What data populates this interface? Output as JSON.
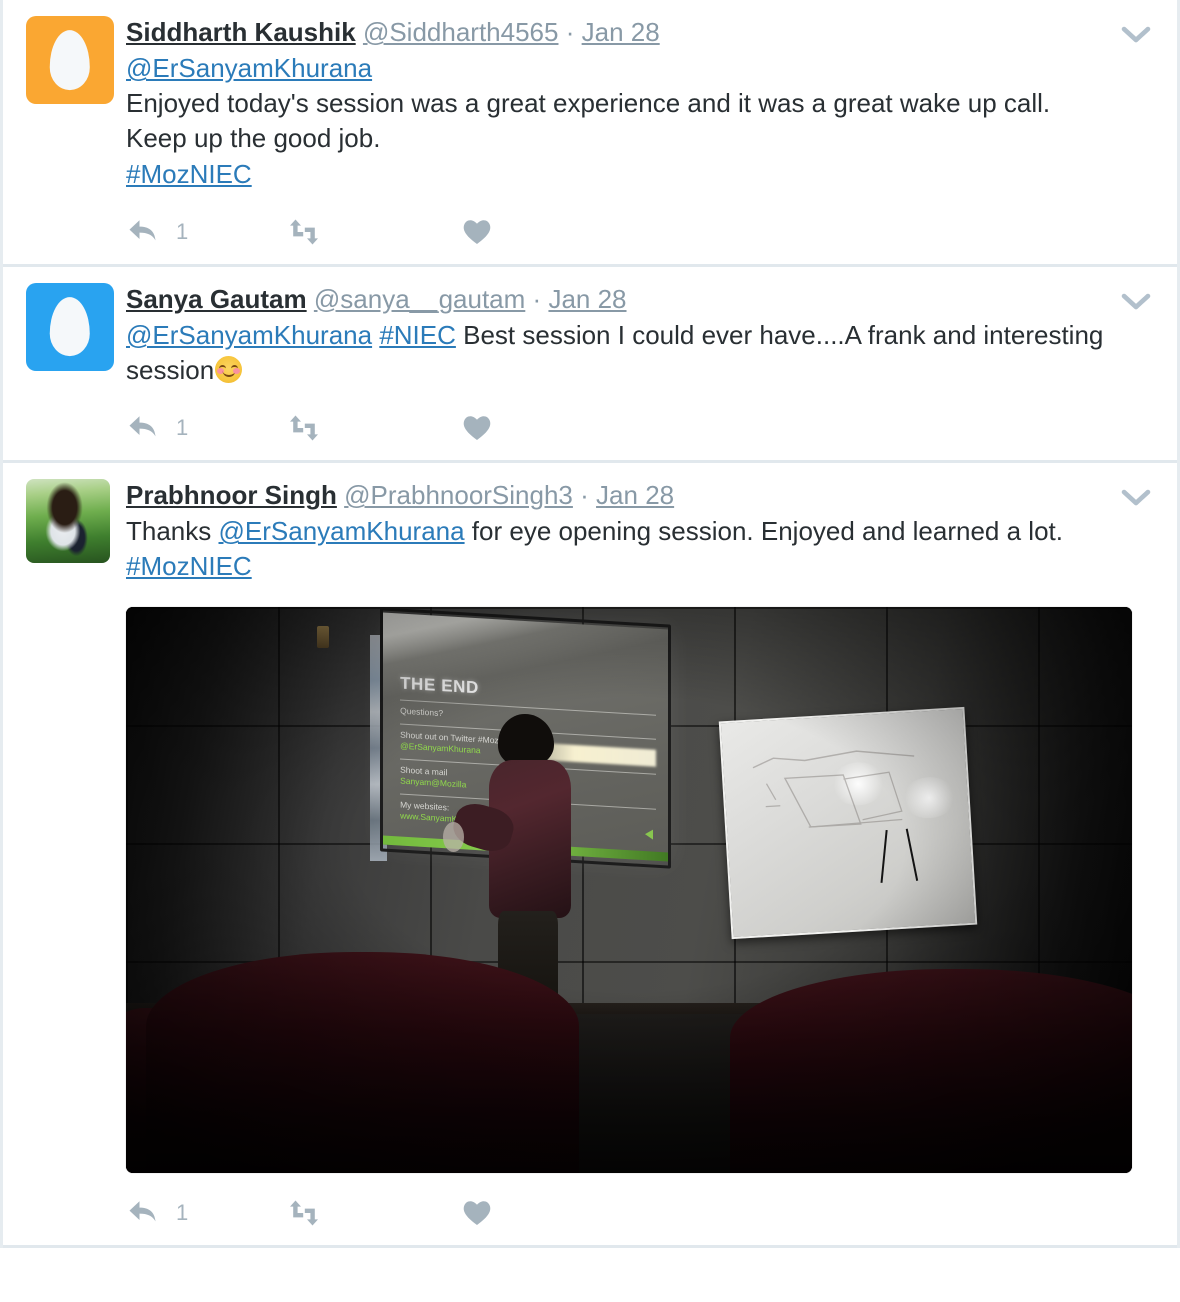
{
  "timeline": {
    "tweets": [
      {
        "avatar": {
          "type": "egg",
          "color": "#faa732",
          "alt": "default-egg-avatar"
        },
        "fullname": "Siddharth Kaushik",
        "username": "@Siddharth4565",
        "separator": "·",
        "timestamp": "Jan 28",
        "text_segments": [
          {
            "type": "mention",
            "text": "@ErSanyamKhurana"
          },
          {
            "type": "br"
          },
          {
            "type": "plain",
            "text": "Enjoyed today's session was a great experience and it was a great wake up call. Keep up the good job."
          },
          {
            "type": "br"
          },
          {
            "type": "hashtag",
            "text": "#MozNIEC"
          }
        ],
        "media": null,
        "actions": {
          "reply_count": "1",
          "retweet_count": "",
          "like_count": ""
        }
      },
      {
        "avatar": {
          "type": "egg",
          "color": "#29a3f0",
          "alt": "default-egg-avatar"
        },
        "fullname": "Sanya Gautam",
        "username": "@sanya__gautam",
        "separator": "·",
        "timestamp": "Jan 28",
        "text_segments": [
          {
            "type": "mention",
            "text": "@ErSanyamKhurana"
          },
          {
            "type": "plain",
            "text": " "
          },
          {
            "type": "hashtag",
            "text": "#NIEC"
          },
          {
            "type": "plain",
            "text": " Best session I could ever have....A frank and interesting session"
          },
          {
            "type": "emoji",
            "text": "smiling-face-with-smiling-eyes"
          }
        ],
        "media": null,
        "actions": {
          "reply_count": "1",
          "retweet_count": "",
          "like_count": ""
        }
      },
      {
        "avatar": {
          "type": "photo",
          "alt": "bearded-man-in-greenery-profile-photo"
        },
        "fullname": "Prabhnoor Singh",
        "username": "@PrabhnoorSingh3",
        "separator": "·",
        "timestamp": "Jan 28",
        "text_segments": [
          {
            "type": "plain",
            "text": "Thanks "
          },
          {
            "type": "mention",
            "text": "@ErSanyamKhurana"
          },
          {
            "type": "plain",
            "text": " for eye opening session. Enjoyed and learned a lot."
          },
          {
            "type": "br"
          },
          {
            "type": "hashtag",
            "text": "#MozNIEC"
          }
        ],
        "media": {
          "alt": "dark-auditorium-speaker-in-front-of-projection-screen",
          "slide": {
            "title": "THE END",
            "lines": [
              {
                "text": "Questions?",
                "style": "white"
              },
              {
                "text": "Shout out on Twitter #MozNIEC",
                "style": "white"
              },
              {
                "text": "@ErSanyamKhurana",
                "style": "green"
              },
              {
                "text": "Shoot a mail",
                "style": "white"
              },
              {
                "text": "Sanyam@Mozilla",
                "style": "green"
              },
              {
                "text": "My websites:",
                "style": "white"
              },
              {
                "text": "www.SanyamKhurana.com  GeekyWay.com",
                "style": "green"
              }
            ]
          }
        },
        "actions": {
          "reply_count": "1",
          "retweet_count": "",
          "like_count": ""
        }
      }
    ]
  },
  "icons": {
    "caret": "chevron-down-icon",
    "reply": "reply-arrow-icon",
    "retweet": "retweet-icon",
    "like": "heart-icon"
  },
  "colors": {
    "link": "#2b7bb9",
    "meta_text": "#8899a6",
    "action_icon": "#a5b3bd",
    "divider": "#e1e8ed",
    "background": "#ffffff"
  }
}
